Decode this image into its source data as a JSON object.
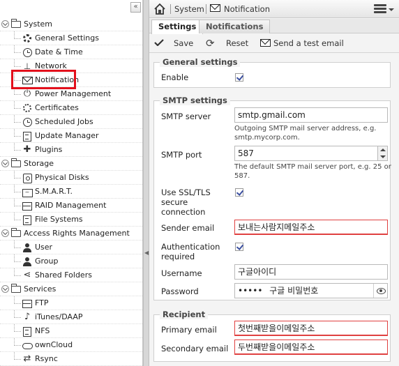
{
  "sidebar": {
    "groups": [
      {
        "label": "System",
        "items": [
          "General Settings",
          "Date & Time",
          "Network",
          "Notification",
          "Power Management",
          "Certificates",
          "Scheduled Jobs",
          "Update Manager",
          "Plugins"
        ]
      },
      {
        "label": "Storage",
        "items": [
          "Physical Disks",
          "S.M.A.R.T.",
          "RAID Management",
          "File Systems"
        ]
      },
      {
        "label": "Access Rights Management",
        "items": [
          "User",
          "Group",
          "Shared Folders"
        ]
      },
      {
        "label": "Services",
        "items": [
          "FTP",
          "iTunes/DAAP",
          "NFS",
          "ownCloud",
          "Rsync"
        ]
      }
    ],
    "collapse_glyph": "«"
  },
  "breadcrumb": {
    "home": "home-icon",
    "section": "System",
    "page": "Notification"
  },
  "tabs": [
    "Settings",
    "Notifications"
  ],
  "toolbar": {
    "save": "Save",
    "reset": "Reset",
    "test": "Send a test email"
  },
  "general": {
    "legend": "General settings",
    "enable_label": "Enable",
    "enable_checked": true
  },
  "smtp": {
    "legend": "SMTP settings",
    "server_label": "SMTP server",
    "server_value": "smtp.gmail.com",
    "server_hint": "Outgoing SMTP mail server address, e.g. smtp.mycorp.com.",
    "port_label": "SMTP port",
    "port_value": "587",
    "port_hint": "The default SMTP mail server port, e.g. 25 or 587.",
    "ssl_label": "Use SSL/TLS secure connection",
    "ssl_checked": true,
    "sender_label": "Sender email",
    "sender_value": "보내는사람지메일주소",
    "auth_label": "Authentication required",
    "auth_checked": true,
    "username_label": "Username",
    "username_value": "구글아이디",
    "password_label": "Password",
    "password_mask": "•••••",
    "password_note": "구글 비밀번호"
  },
  "recipient": {
    "legend": "Recipient",
    "primary_label": "Primary email",
    "primary_value": "첫번째받을이메일주소",
    "secondary_label": "Secondary email",
    "secondary_value": "두번째받을이메일주소"
  },
  "colors": {
    "highlight": "#e3101c",
    "check": "#3b4fa0",
    "warn_border": "#e04040"
  }
}
